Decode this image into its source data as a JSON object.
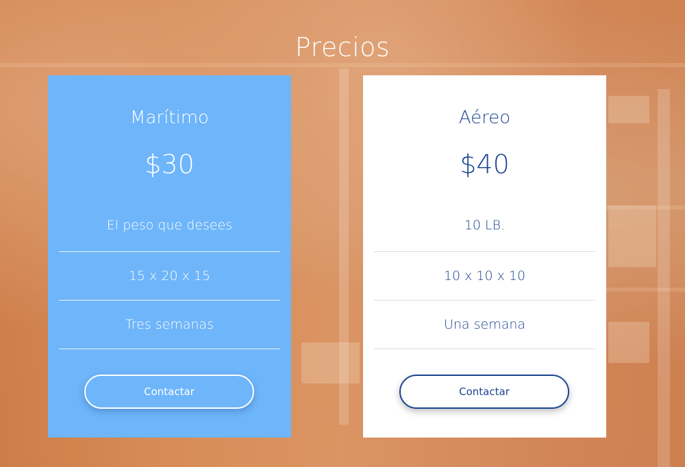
{
  "section": {
    "title": "Precios"
  },
  "plans": [
    {
      "name": "Marítimo",
      "price": "$30",
      "features": [
        "El peso que desees",
        "15 x 20 x 15",
        "Tres semanas"
      ],
      "button_label": "Contactar"
    },
    {
      "name": "Aéreo",
      "price": "$40",
      "features": [
        "10 LB.",
        "10 x 10 x 10",
        "Una semana"
      ],
      "button_label": "Contactar"
    }
  ],
  "colors": {
    "maritime_card_bg": "#6eb5fa",
    "air_card_bg": "#ffffff",
    "air_text": "#1b4591",
    "overlay_tint": "#d68b5a"
  }
}
